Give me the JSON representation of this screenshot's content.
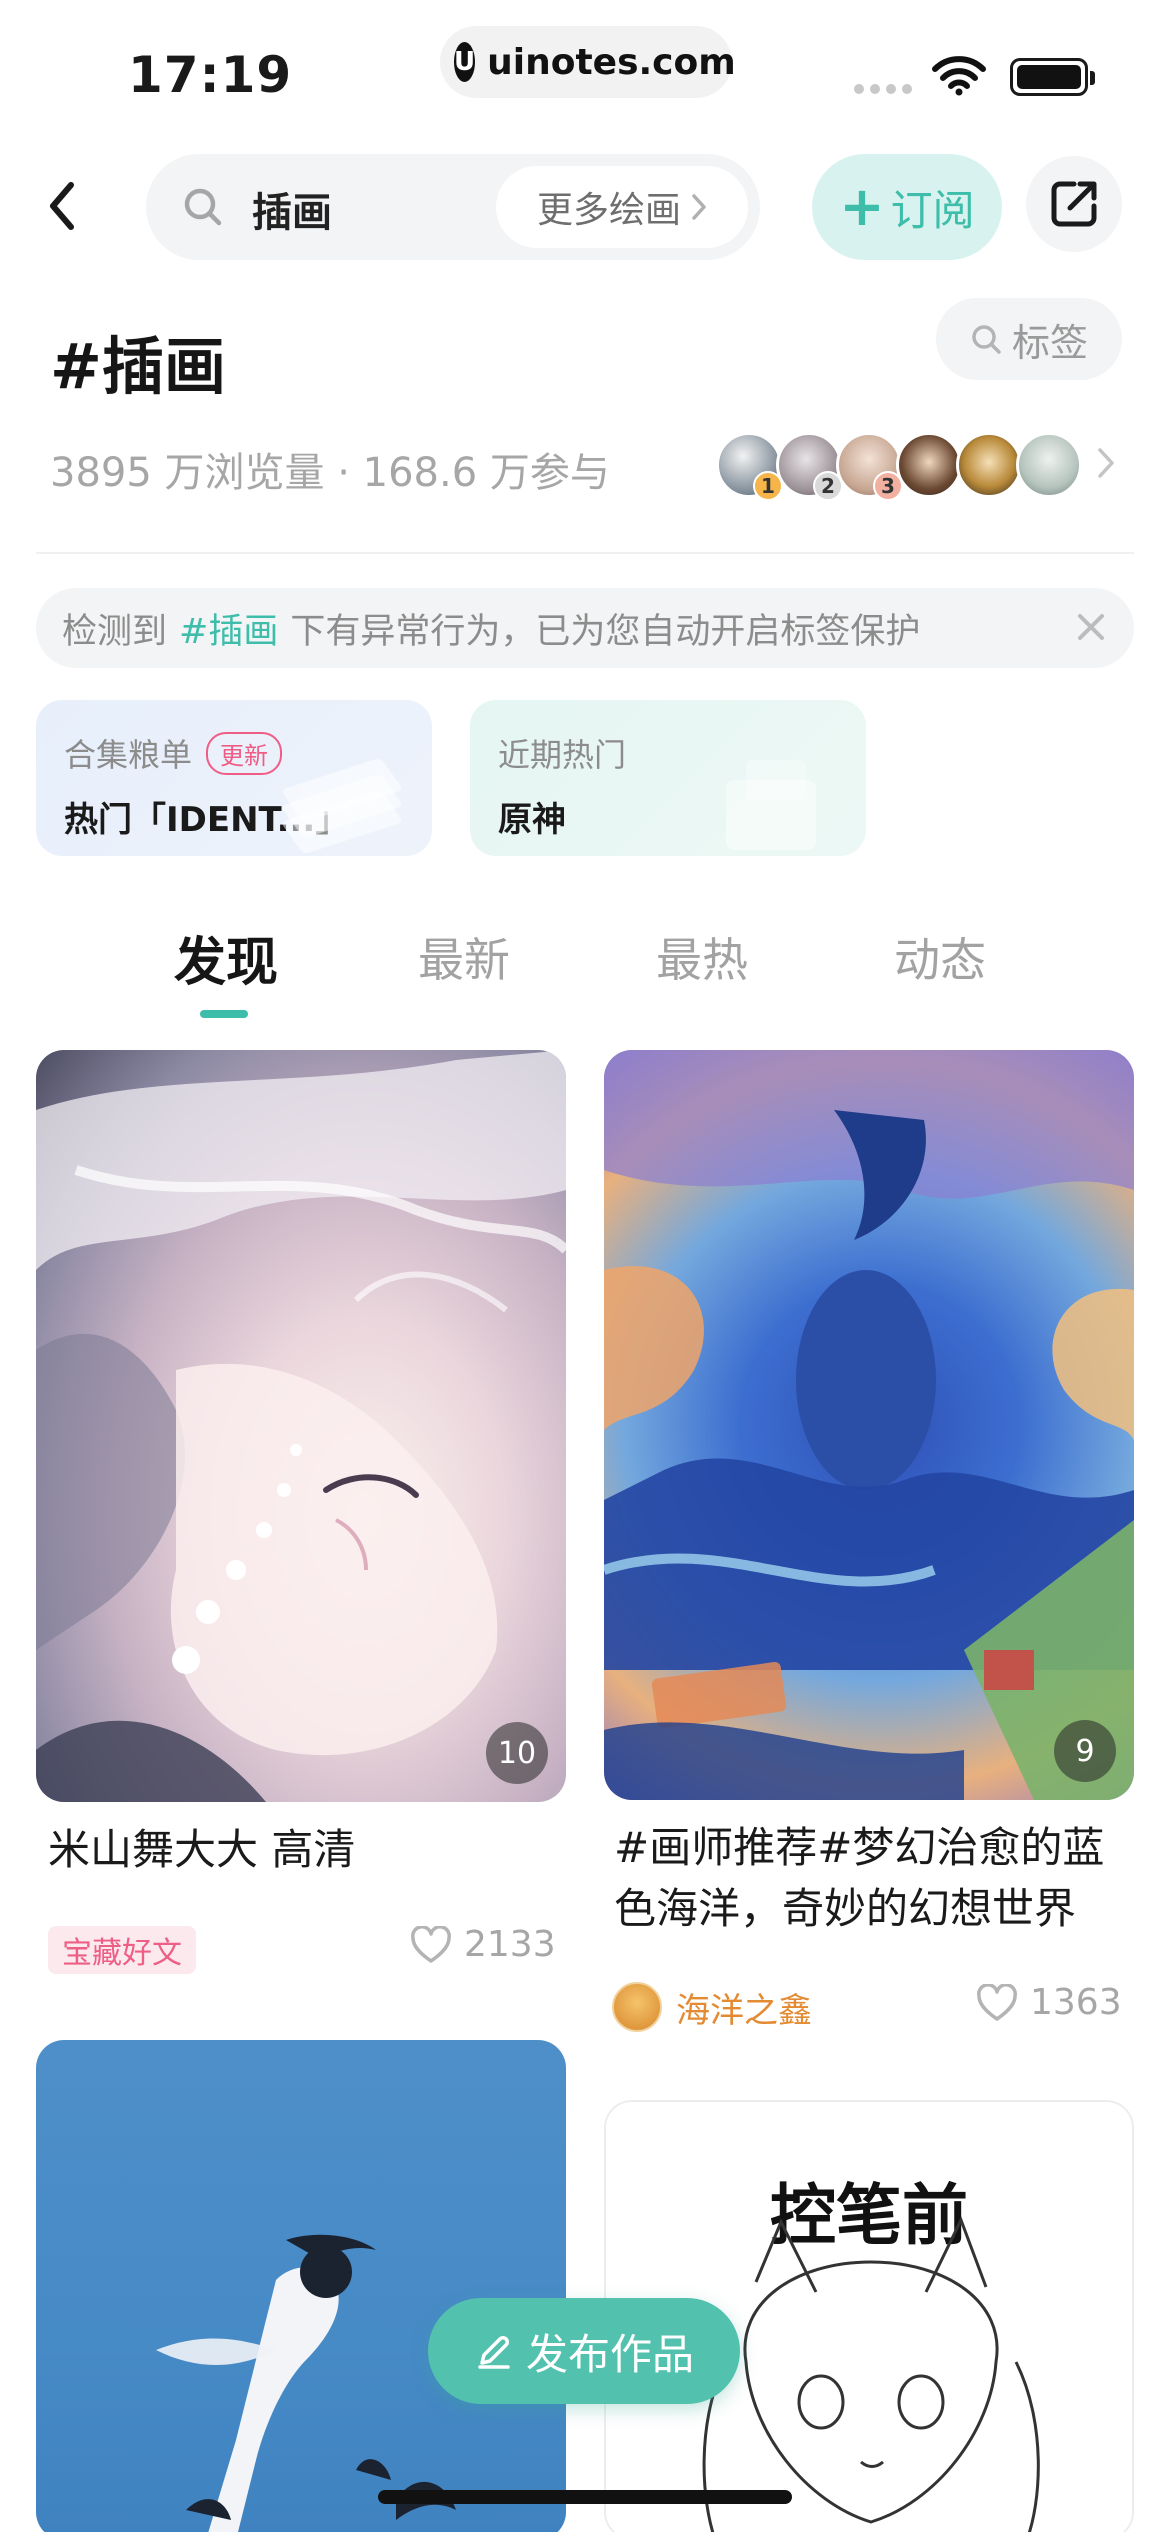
{
  "status_bar": {
    "time": "17:19",
    "url": "uinotes.com",
    "url_logo": "U"
  },
  "search": {
    "query": "插画",
    "more_label": "更多绘画"
  },
  "actions": {
    "subscribe_plus": "+",
    "subscribe_label": "订阅"
  },
  "topic": {
    "title": "#插画",
    "tag_label": "标签",
    "stats": "3895 万浏览量 · 168.6 万参与",
    "top_users": [
      {
        "rank": "1",
        "rank_color": "#f5b54a"
      },
      {
        "rank": "2",
        "rank_color": "#d9d9d9"
      },
      {
        "rank": "3",
        "rank_color": "#f2b0a0"
      }
    ]
  },
  "notice": {
    "prefix": "检测到",
    "highlight": "#插画",
    "suffix": "下有异常行为，已为您自动开启标签保护"
  },
  "cards": {
    "collection": {
      "label": "合集粮单",
      "badge": "更新",
      "value": "热门「IDENT...」"
    },
    "hot": {
      "label": "近期热门",
      "value": "原神"
    }
  },
  "tabs": [
    "发现",
    "最新",
    "最热",
    "动态"
  ],
  "posts": {
    "left1": {
      "count": "10",
      "title": "米山舞大大 高清",
      "tag": "宝藏好文",
      "likes": "2133"
    },
    "right1": {
      "count": "9",
      "title_line1": "#画师推荐#梦幻治愈的蓝",
      "title_line2": "色海洋，奇妙的幻想世界",
      "author": "海洋之鑫",
      "likes": "1363"
    },
    "right2": {
      "image_text": "控笔前"
    }
  },
  "publish": {
    "label": "发布作品"
  },
  "colors": {
    "accent": "#3dbdaa",
    "pink": "#ee5f85",
    "author": "#e38a32"
  }
}
